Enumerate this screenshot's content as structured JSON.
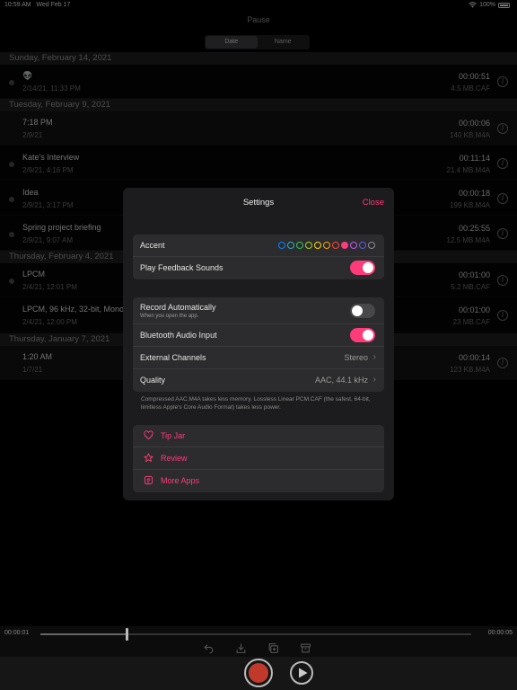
{
  "status": {
    "time": "10:59 AM",
    "date": "Wed Feb 17",
    "battery": "100%"
  },
  "nav": {
    "title": "Pause"
  },
  "segment": {
    "date": "Date",
    "name": "Name"
  },
  "sections": [
    {
      "header": "Sunday, February 14, 2021"
    },
    {
      "header": "Tuesday, February 9, 2021"
    },
    {
      "header": "Thursday, February 4, 2021"
    },
    {
      "header": "Thursday, January 7, 2021"
    }
  ],
  "recordings": [
    {
      "name": "👽",
      "date": "2/14/21, 11:33 PM",
      "duration": "00:00:51",
      "size": "4.5 MB.CAF"
    },
    {
      "name": "7:18 PM",
      "date": "2/9/21",
      "duration": "00:00:06",
      "size": "140 KB.M4A"
    },
    {
      "name": "Kate's Interview",
      "date": "2/9/21, 4:16 PM",
      "duration": "00:11:14",
      "size": "21.4 MB.M4A"
    },
    {
      "name": "Idea",
      "date": "2/9/21, 3:17 PM",
      "duration": "00:00:18",
      "size": "199 KB.M4A"
    },
    {
      "name": "Spring project briefing",
      "date": "2/9/21, 9:07 AM",
      "duration": "00:25:55",
      "size": "12.5 MB.M4A"
    },
    {
      "name": "LPCM",
      "date": "2/4/21, 12:01 PM",
      "duration": "00:01:00",
      "size": "5.2 MB.CAF"
    },
    {
      "name": "LPCM, 96 kHz, 32-bit, Mono",
      "date": "2/4/21, 12:00 PM",
      "duration": "00:01:00",
      "size": "23 MB.CAF"
    },
    {
      "name": "1:20 AM",
      "date": "1/7/21",
      "duration": "00:00:14",
      "size": "123 KB.M4A"
    }
  ],
  "settings": {
    "title": "Settings",
    "close": "Close",
    "accent_label": "Accent",
    "accent_colors": [
      "#0a84ff",
      "#30b0c7",
      "#34c759",
      "#a0d911",
      "#ffd60a",
      "#ff9f0a",
      "#ff453a",
      "#ff3b79",
      "#bf5af2",
      "#5e5ce6",
      "#8e8e93"
    ],
    "accent_selected": 7,
    "feedback_label": "Play Feedback Sounds",
    "feedback_on": true,
    "record_auto_label": "Record Automatically",
    "record_auto_sub": "When you open the app.",
    "record_auto_on": false,
    "bluetooth_label": "Bluetooth Audio Input",
    "bluetooth_on": true,
    "channels_label": "External Channels",
    "channels_value": "Stereo",
    "quality_label": "Quality",
    "quality_value": "AAC, 44.1 kHz",
    "footnote": "Compressed AAC.M4A takes less memory. Lossless Linear PCM.CAF (the safest, 64-bit, limitless Apple's Core Audio Format) takes less power.",
    "tip_jar": "Tip Jar",
    "review": "Review",
    "more_apps": "More Apps"
  },
  "player": {
    "elapsed": "00:00:01",
    "total": "00:00:05",
    "progress": 0.2
  },
  "colors": {
    "accent": "#ff3b79",
    "record": "#c0392b"
  }
}
